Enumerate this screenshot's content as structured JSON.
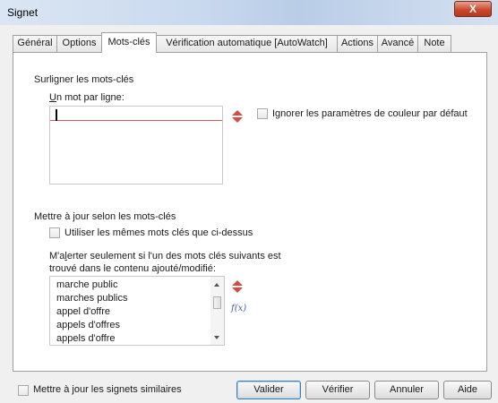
{
  "window": {
    "title": "Signet",
    "close_label": "X"
  },
  "tabs": [
    {
      "label": "Général"
    },
    {
      "label": "Options"
    },
    {
      "label": "Mots-clés"
    },
    {
      "label": "Vérification automatique [AutoWatch]"
    },
    {
      "label": "Actions"
    },
    {
      "label": "Avancé"
    },
    {
      "label": "Note"
    }
  ],
  "active_tab": "Mots-clés",
  "highlight": {
    "section_title": "Surligner les mots-clés",
    "field_label_accel": "U",
    "field_label_rest": "n mot par ligne:",
    "value": "",
    "ignore_color_label": "Ignorer les paramètres de couleur par défaut",
    "ignore_color_checked": false
  },
  "update": {
    "section_title": "Mettre à jour selon les mots-clés",
    "use_same_label": "Utiliser les mêmes mots clés que ci-dessus",
    "use_same_checked": false,
    "alert_line1_a": "M'a",
    "alert_line1_accel": "l",
    "alert_line1_b": "erter seulement si l'un des mots clés suivants est",
    "alert_line2": "trouvé dans le contenu ajouté/modifié:",
    "keywords": [
      "marche public",
      "marches publics",
      "appel d'offre",
      "appels d'offres",
      "appels d'offre"
    ],
    "fx_label": "f(x)"
  },
  "footer": {
    "update_similar_label": "Mettre à jour les signets similaires",
    "update_similar_checked": false,
    "buttons": {
      "ok": "Valider",
      "check": "Vérifier",
      "cancel": "Annuler",
      "help": "Aide"
    }
  }
}
